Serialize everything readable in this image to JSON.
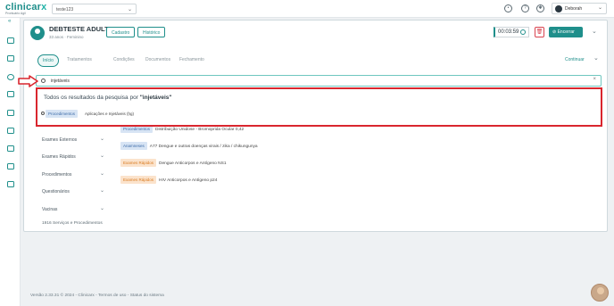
{
  "app": {
    "logo_text": "clinicar",
    "logo_x": "x",
    "logo_sub": "Prontuário Agil"
  },
  "topbar": {
    "unit_select_value": "teste123",
    "user_name": "Deborah"
  },
  "patient": {
    "name": "DEBTESTE ADULTO",
    "info": "33 anos · Feminino",
    "btn_register": "Cadastro",
    "btn_history": "Histórico",
    "timer": "00:03:59",
    "btn_end": "Encerrar"
  },
  "tabs": [
    {
      "label": "Início"
    },
    {
      "label": "Tratamentos"
    },
    {
      "label": "Condições"
    },
    {
      "label": "Documentos"
    },
    {
      "label": "Fechamento"
    }
  ],
  "continue_label": "Continuar",
  "search": {
    "value": "injetáveis"
  },
  "results": {
    "title_prefix": "Todos os resultados da pesquisa por",
    "title_query": "\"injetáveis\"",
    "row_badge": "Procedimentos",
    "row_text": "Aplicações e Injetáveis (ḥg)"
  },
  "categories": [
    {
      "label": "Exames Externos"
    },
    {
      "label": "Exames Rápidos"
    },
    {
      "label": "Procedimentos"
    },
    {
      "label": "Questionários"
    },
    {
      "label": "Vacinas"
    }
  ],
  "total_label": "1916 Serviços e Procedimentos",
  "items": [
    {
      "badge": "Procedimentos",
      "text": "Distribuição Unidose - Bromoprida Ocular 0,42",
      "color": "blue"
    },
    {
      "badge": "Anamneses",
      "text": "A77 Dengue e outras doenças virais / zika / chikungunya",
      "color": "blue"
    },
    {
      "badge": "Exames Rápidos",
      "text": "Dengue Anticorpos e Antígeno NS1",
      "color": "orange"
    },
    {
      "badge": "Exames Rápidos",
      "text": "HIV Anticorpos e Antígeno p24",
      "color": "orange"
    }
  ],
  "footer": "Versão 2.33.31  ©  2024 - Clinicarx - Termos de uso - Status do sistema",
  "colors": {
    "brand": "#1f8f8b",
    "highlight_border": "#d9262e",
    "danger": "#d9434f"
  }
}
